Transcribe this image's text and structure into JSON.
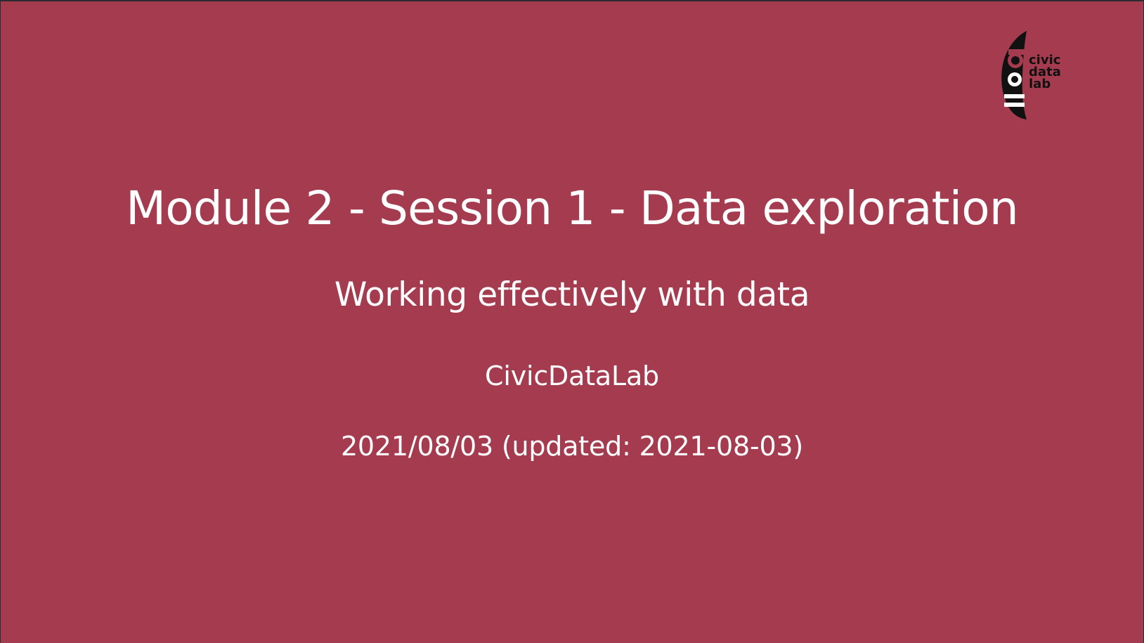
{
  "slide": {
    "background_color": "#a53b4f",
    "title": "Module 2 - Session 1 - Data exploration",
    "subtitle": "Working effectively with data",
    "author": "CivicDataLab",
    "date": "2021/08/03 (updated: 2021-08-03)"
  },
  "logo": {
    "icon": "civic-data-lab-logo",
    "lines": [
      "civic",
      "data",
      "lab"
    ]
  }
}
